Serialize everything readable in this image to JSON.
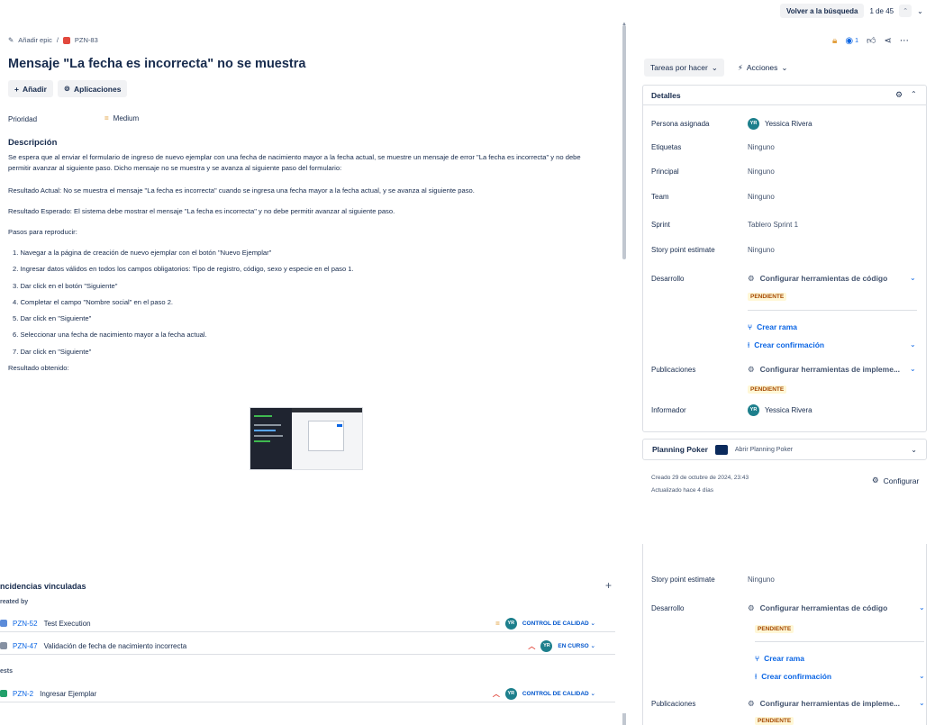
{
  "topbar": {
    "back_search": "Volver a la búsqueda",
    "counter": "1 de 45"
  },
  "breadcrumb": {
    "epic": "Añadir epic",
    "issue_key": "PZN-83"
  },
  "issue": {
    "title": "Mensaje \"La fecha es incorrecta\" no se muestra",
    "add_label": "Añadir",
    "apps_label": "Aplicaciones",
    "priority_label": "Prioridad",
    "priority_value": "Medium",
    "description_heading": "Descripción",
    "description_p1": "Se espera que al enviar el formulario de ingreso de nuevo ejemplar con una fecha de nacimiento mayor a la fecha actual, se muestre un mensaje de error \"La fecha es incorrecta\" y no debe permitir avanzar al siguiente paso. Dicho mensaje no se muestra y se avanza al siguiente paso del formulario:",
    "actual": "Resultado Actual: No se muestra el mensaje \"La fecha es incorrecta\" cuando se ingresa una fecha mayor a la fecha actual, y se avanza al siguiente paso.",
    "expected": "Resultado Esperado: El sistema debe mostrar el mensaje \"La fecha es incorrecta\" y no debe permitir avanzar al siguiente paso.",
    "steps_heading": "Pasos para reproducir:",
    "steps": [
      "1. Navegar a la página de creación de nuevo ejemplar con el botón \"Nuevo Ejemplar\"",
      "2. Ingresar datos válidos en todos los campos obligatorios: Tipo de registro, código, sexo y especie en el paso 1.",
      "3. Dar click en el botón \"Siguiente\"",
      "4. Completar el campo \"Nombre social\" en el paso 2.",
      "5. Dar click en \"Siguiente\"",
      "6. Seleccionar una fecha de nacimiento mayor a la fecha actual.",
      "7. Dar click en \"Siguiente\""
    ],
    "obtained": "Resultado obtenido:"
  },
  "right": {
    "status_btn": "Tareas por hacer",
    "actions_btn": "Acciones",
    "watchers": "1",
    "details_heading": "Detalles",
    "assignee_label": "Persona asignada",
    "assignee_initials": "YR",
    "assignee_name": "Yessica Rivera",
    "labels_label": "Etiquetas",
    "labels_value": "Ninguno",
    "parent_label": "Principal",
    "parent_value": "Ninguno",
    "team_label": "Team",
    "team_value": "Ninguno",
    "sprint_label": "Sprint",
    "sprint_value": "Tablero Sprint 1",
    "sp_label": "Story point estimate",
    "sp_value": "Ninguno",
    "dev_label": "Desarrollo",
    "dev_config": "Configurar herramientas de código",
    "pending": "PENDIENTE",
    "create_branch": "Crear rama",
    "create_commit": "Crear confirmación",
    "releases_label": "Publicaciones",
    "releases_config": "Configurar herramientas de impleme...",
    "reporter_label": "Informador",
    "reporter_initials": "YR",
    "reporter_name": "Yessica Rivera",
    "poker_label": "Planning Poker",
    "poker_open": "Abrir Planning Poker",
    "created": "Creado 29 de octubre de 2024, 23:43",
    "updated": "Actualizado hace 4 días",
    "configure": "Configurar"
  },
  "linked": {
    "heading": "ncidencias vinculadas",
    "group1": "reated by",
    "group2": "ests",
    "items": [
      {
        "key": "PZN-52",
        "title": "Test Execution",
        "status": "CONTROL DE CALIDAD",
        "initials": "YR"
      },
      {
        "key": "PZN-47",
        "title": "Validación de fecha de nacimiento incorrecta",
        "status": "EN CURSO",
        "initials": "YR"
      },
      {
        "key": "PZN-2",
        "title": "Ingresar Ejemplar",
        "status": "CONTROL DE CALIDAD",
        "initials": "YR"
      }
    ]
  },
  "right2": {
    "sp_label": "Story point estimate",
    "sp_value": "Ninguno",
    "dev_label": "Desarrollo",
    "dev_config": "Configurar herramientas de código",
    "pending": "PENDIENTE",
    "create_branch": "Crear rama",
    "create_commit": "Crear confirmación",
    "releases_label": "Publicaciones",
    "releases_config": "Configurar herramientas de impleme...",
    "pending2": "PENDIENTE"
  }
}
